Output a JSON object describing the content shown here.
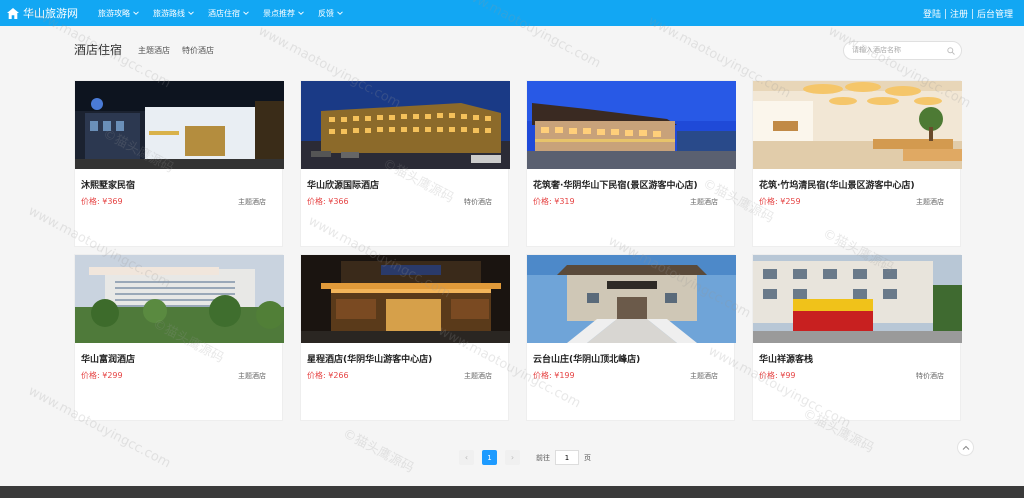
{
  "site": {
    "title": "华山旅游网"
  },
  "nav": [
    {
      "label": "旅游攻略"
    },
    {
      "label": "旅游路线"
    },
    {
      "label": "酒店住宿"
    },
    {
      "label": "景点推荐"
    },
    {
      "label": "反馈"
    }
  ],
  "auth": {
    "login": "登陆",
    "register": "注册",
    "admin": "后台管理"
  },
  "section": {
    "title": "酒店住宿",
    "tabs": [
      "主题酒店",
      "特价酒店"
    ]
  },
  "search": {
    "placeholder": "请输入酒店名称"
  },
  "hotels": [
    {
      "name": "沐熙墅家民宿",
      "price": "价格: ¥369",
      "category": "主题酒店"
    },
    {
      "name": "华山欣源国际酒店",
      "price": "价格: ¥366",
      "category": "特价酒店"
    },
    {
      "name": "花筑奢·华阴华山下民宿(景区游客中心店)",
      "price": "价格: ¥319",
      "category": "主题酒店"
    },
    {
      "name": "花筑·竹坞清民宿(华山景区游客中心店)",
      "price": "价格: ¥259",
      "category": "主题酒店"
    },
    {
      "name": "华山富润酒店",
      "price": "价格: ¥299",
      "category": "主题酒店"
    },
    {
      "name": "星程酒店(华阴华山游客中心店)",
      "price": "价格: ¥266",
      "category": "主题酒店"
    },
    {
      "name": "云台山庄(华阴山顶北峰店)",
      "price": "价格: ¥199",
      "category": "主题酒店"
    },
    {
      "name": "华山祥源客栈",
      "price": "价格: ¥99",
      "category": "特价酒店"
    }
  ],
  "pagination": {
    "prev": "‹",
    "current": "1",
    "next": "›",
    "goto_label": "前往",
    "goto_value": "1",
    "page_suffix": "页"
  },
  "watermark": {
    "text": "www.maotouyingcc.com",
    "alt": "©猫头鹰源码"
  },
  "colors": {
    "nav_bg": "#12a7f3",
    "price": "#e64545",
    "page_active": "#1e9bff"
  },
  "icons": {
    "home": "home-icon",
    "search": "search-icon",
    "chevron": "chevron-down-icon",
    "top": "arrow-up-icon"
  }
}
